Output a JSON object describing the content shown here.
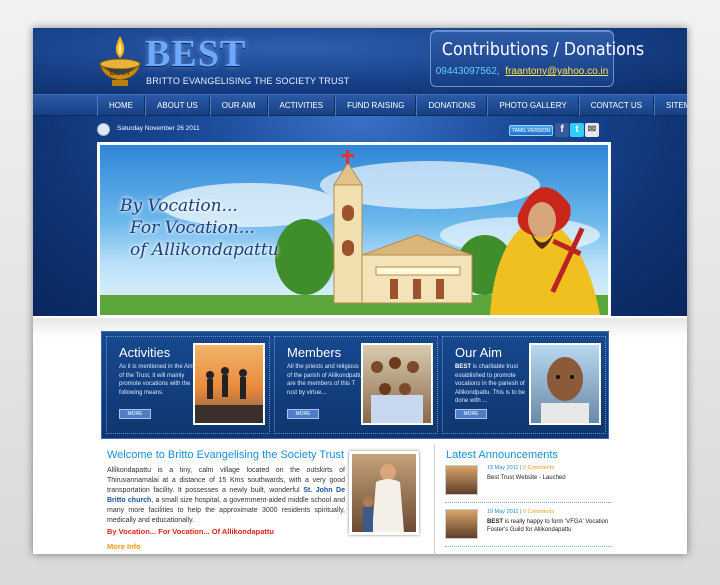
{
  "brand": {
    "logo": "BEST",
    "subtitle": "BRITTO EVANGELISING THE SOCIETY TRUST",
    "lamp_label": "BEST"
  },
  "donate": {
    "title": "Contributions / Donations",
    "phone": "09443097562,",
    "email": "fraantony@yahoo.co.in"
  },
  "nav": [
    "HOME",
    "ABOUT US",
    "OUR AIM",
    "ACTIVITIES",
    "FUND RAISING",
    "DONATIONS",
    "PHOTO GALLERY",
    "CONTACT US",
    "SITEMAP"
  ],
  "topbar": {
    "date": "Saturday November 26 2011",
    "tamil_version": "TAMIL VERSION",
    "social_icons": [
      "facebook-icon",
      "twitter-icon",
      "mail-icon"
    ]
  },
  "banner": {
    "line1": "By Vocation...",
    "line2": "For Vocation...",
    "line3": "of Allikondapattu"
  },
  "tiles": [
    {
      "title": "Activities",
      "text": "As it is mentioned in the Aim of the Trust, it will mainly promote vocations with the following means.",
      "more": "MORE"
    },
    {
      "title": "Members",
      "text": "All the priests and religious of the parish of Allikondpattu are the members of this T rust by virtue...",
      "more": "MORE"
    },
    {
      "title": "Our Aim",
      "text_bold": "BEST",
      "text": " is charitable trust established to promote vocations in the pariesh of Allikondpattu. This is to be done with ...",
      "more": "MORE"
    }
  ],
  "welcome": {
    "title": "Welcome to Britto Evangelising the Society Trust",
    "body_1": "Allikondapattu is a tiny, calm village located on the outskirts of Thiruvannamalai at a distance of 15 Kms southwards, with a very good transportation facility. It possesses a newly built, wonderful ",
    "body_bold": "St. John De Britto church",
    "body_2": ", a small size hospital, a government-aided middle school and many more facilities to help the approximate 3000 residents spiritually, medically and educationally.",
    "tagline": "By Vocation... For Vocation... Of Allikondapattu",
    "more_info": "More Info"
  },
  "announcements": {
    "title": "Latest Announcements",
    "items": [
      {
        "date": "19 May 2011",
        "comments": "0 Comments",
        "text_bold": "",
        "text": "Best Trust Website - Lauched"
      },
      {
        "date": "19 May 2011",
        "comments": "0 Comments",
        "text_bold": "BEST",
        "text": " is really happy to form 'VFGA' Vocation Foster's Guild for Allikondapattu"
      }
    ]
  },
  "colors": {
    "header_blue": "#163f86",
    "link_blue": "#1b8ed6",
    "accent_orange": "#f29a14",
    "tagline_red": "#d9261c",
    "email_yellow": "#ffe14a"
  }
}
